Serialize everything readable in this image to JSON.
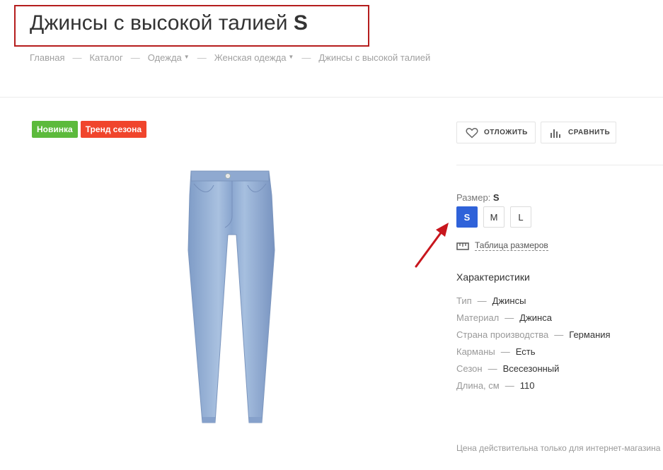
{
  "header": {
    "title": "Джинсы с высокой талией",
    "title_size": "S"
  },
  "breadcrumb": [
    {
      "label": "Главная",
      "dropdown": false
    },
    {
      "label": "Каталог",
      "dropdown": false
    },
    {
      "label": "Одежда",
      "dropdown": true
    },
    {
      "label": "Женская одежда",
      "dropdown": true
    },
    {
      "label": "Джинсы с высокой талией",
      "dropdown": false
    }
  ],
  "breadcrumb_separator": "—",
  "badges": [
    {
      "label": "Новинка",
      "color": "#5cba3c"
    },
    {
      "label": "Тренд сезона",
      "color": "#f0452c"
    }
  ],
  "actions": {
    "defer_label": "ОТЛОЖИТЬ",
    "compare_label": "СРАВНИТЬ"
  },
  "size": {
    "label": "Размер:",
    "selected": "S",
    "options": [
      "S",
      "M",
      "L"
    ],
    "table_link": "Таблица размеров"
  },
  "characteristics": {
    "title": "Характеристики",
    "separator": "—",
    "items": [
      {
        "name": "Тип",
        "value": "Джинсы"
      },
      {
        "name": "Материал",
        "value": "Джинса"
      },
      {
        "name": "Страна производства",
        "value": "Германия"
      },
      {
        "name": "Карманы",
        "value": "Есть"
      },
      {
        "name": "Сезон",
        "value": "Всесезонный"
      },
      {
        "name": "Длина, см",
        "value": "110"
      }
    ]
  },
  "price_note": "Цена действительна только для интернет-магазина",
  "icons": {
    "defer": "heart-icon",
    "compare": "bar-chart-icon",
    "size_table": "ruler-icon"
  },
  "colors": {
    "accent": "#2f62d9",
    "title_frame": "#b51d1d",
    "arrow": "#c8161d"
  }
}
